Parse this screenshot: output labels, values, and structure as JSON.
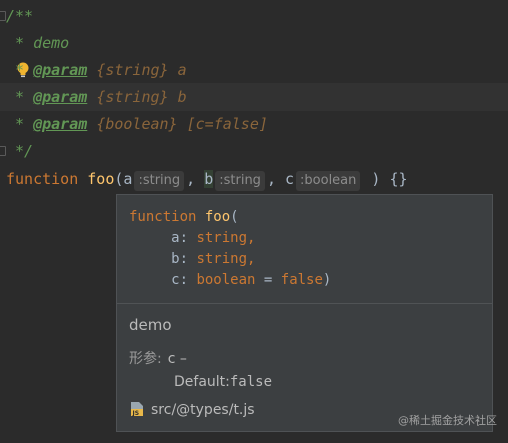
{
  "editor": {
    "line1": {
      "open": "/**"
    },
    "line2": {
      "star": " * ",
      "text": "demo"
    },
    "line3": {
      "star": " * ",
      "tag": "@param",
      "type": "{string}",
      "name": "a"
    },
    "line4": {
      "star": " * ",
      "tag": "@param",
      "type": "{string}",
      "name": "b"
    },
    "line5": {
      "star": " * ",
      "tag": "@param",
      "type": "{boolean}",
      "name": "[c=false]"
    },
    "line6": {
      "close": " */"
    },
    "line7": {
      "keyword": "function",
      "name": "foo",
      "open_paren": "(",
      "p1": "a",
      "hint1": ":string",
      "comma1": ",",
      "p2": "b",
      "hint2": ":string",
      "comma2": ",",
      "p3": "c",
      "hint3": ":boolean",
      "close": ") {}"
    }
  },
  "popup": {
    "sig_keyword": "function",
    "sig_name": "foo",
    "sig_open": "(",
    "params": [
      {
        "name": "a:",
        "type": "string,"
      },
      {
        "name": "b:",
        "type": "string,"
      },
      {
        "name": "c:",
        "type": "boolean",
        "eq": " = ",
        "default": "false",
        "close": ")"
      }
    ],
    "description": "demo",
    "params_label": "形参:",
    "param_c": "c –",
    "default_label": "Default:",
    "default_value": "false",
    "source_file": "src/@types/t.js"
  },
  "icons": {
    "bulb": "lightbulb-icon",
    "js_file": "js-file-icon",
    "more": "more-vertical-icon"
  },
  "watermark": "@稀土掘金技术社区"
}
